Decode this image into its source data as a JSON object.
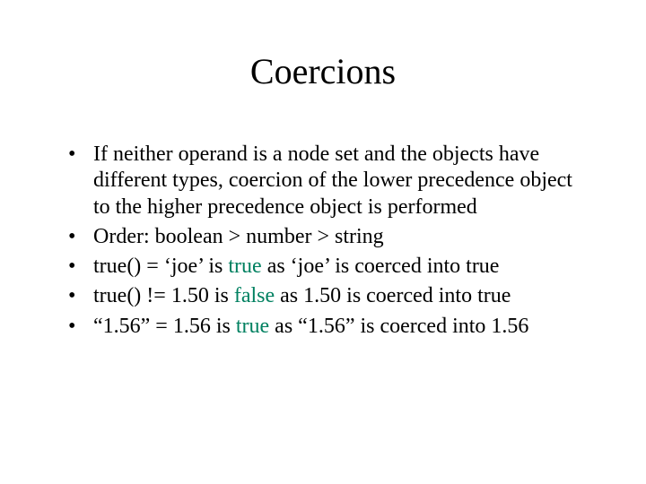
{
  "title": "Coercions",
  "bullets": [
    {
      "kind": "plain",
      "text": "If neither operand is a node set and the objects have different types, coercion of the lower precedence object to the higher precedence object is performed"
    },
    {
      "kind": "plain",
      "text": "Order: boolean > number > string"
    },
    {
      "kind": "tf",
      "pre": "true() = ‘joe’ is ",
      "tf": "true",
      "post": " as ‘joe’ is coerced into true"
    },
    {
      "kind": "tf",
      "pre": "true() != 1.50 is ",
      "tf": "false",
      "post": " as 1.50 is coerced into true"
    },
    {
      "kind": "tf",
      "pre": "“1.56” = 1.56 is ",
      "tf": "true",
      "post": " as “1.56” is coerced into 1.56"
    }
  ]
}
